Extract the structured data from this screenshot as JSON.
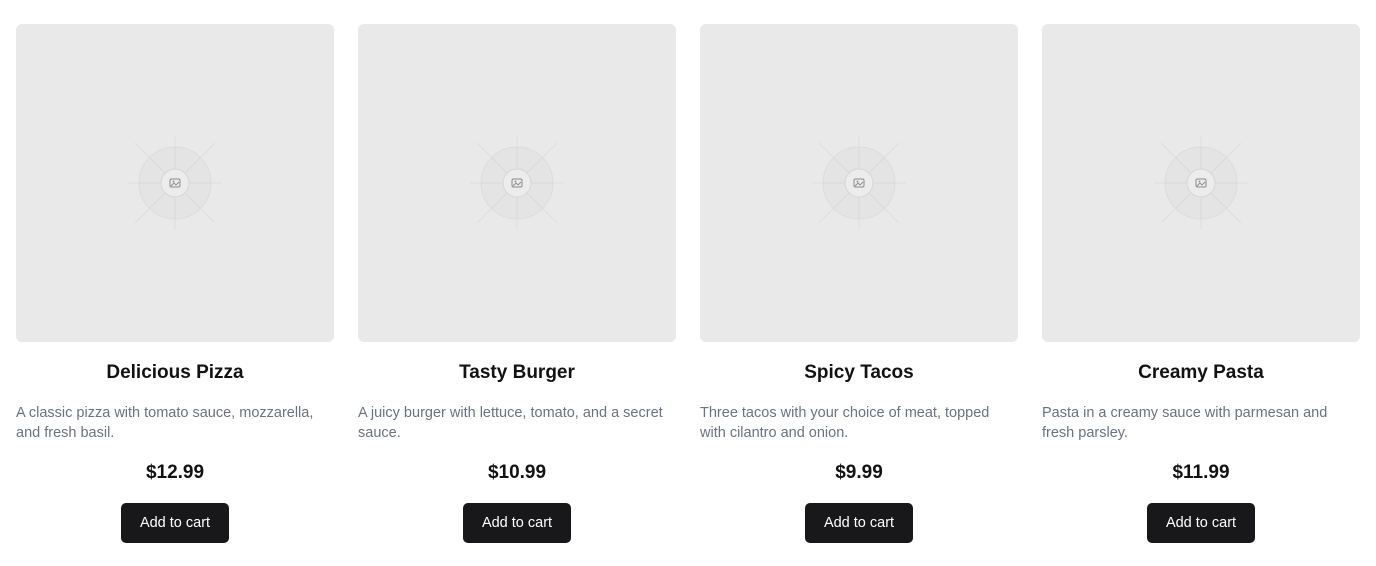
{
  "products": [
    {
      "name": "Delicious Pizza",
      "description": "A classic pizza with tomato sauce, mozzarella, and fresh basil.",
      "price": "$12.99",
      "button_label": "Add to cart",
      "image_icon": "image-placeholder-icon"
    },
    {
      "name": "Tasty Burger",
      "description": "A juicy burger with lettuce, tomato, and a secret sauce.",
      "price": "$10.99",
      "button_label": "Add to cart",
      "image_icon": "image-placeholder-icon"
    },
    {
      "name": "Spicy Tacos",
      "description": "Three tacos with your choice of meat, topped with cilantro and onion.",
      "price": "$9.99",
      "button_label": "Add to cart",
      "image_icon": "image-placeholder-icon"
    },
    {
      "name": "Creamy Pasta",
      "description": "Pasta in a creamy sauce with parmesan and fresh parsley.",
      "price": "$11.99",
      "button_label": "Add to cart",
      "image_icon": "image-placeholder-icon"
    }
  ],
  "colors": {
    "image_bg": "#e9e9e9",
    "button_bg": "#18181b",
    "button_text": "#ffffff",
    "description_text": "#6b7280",
    "title_text": "#121212"
  }
}
